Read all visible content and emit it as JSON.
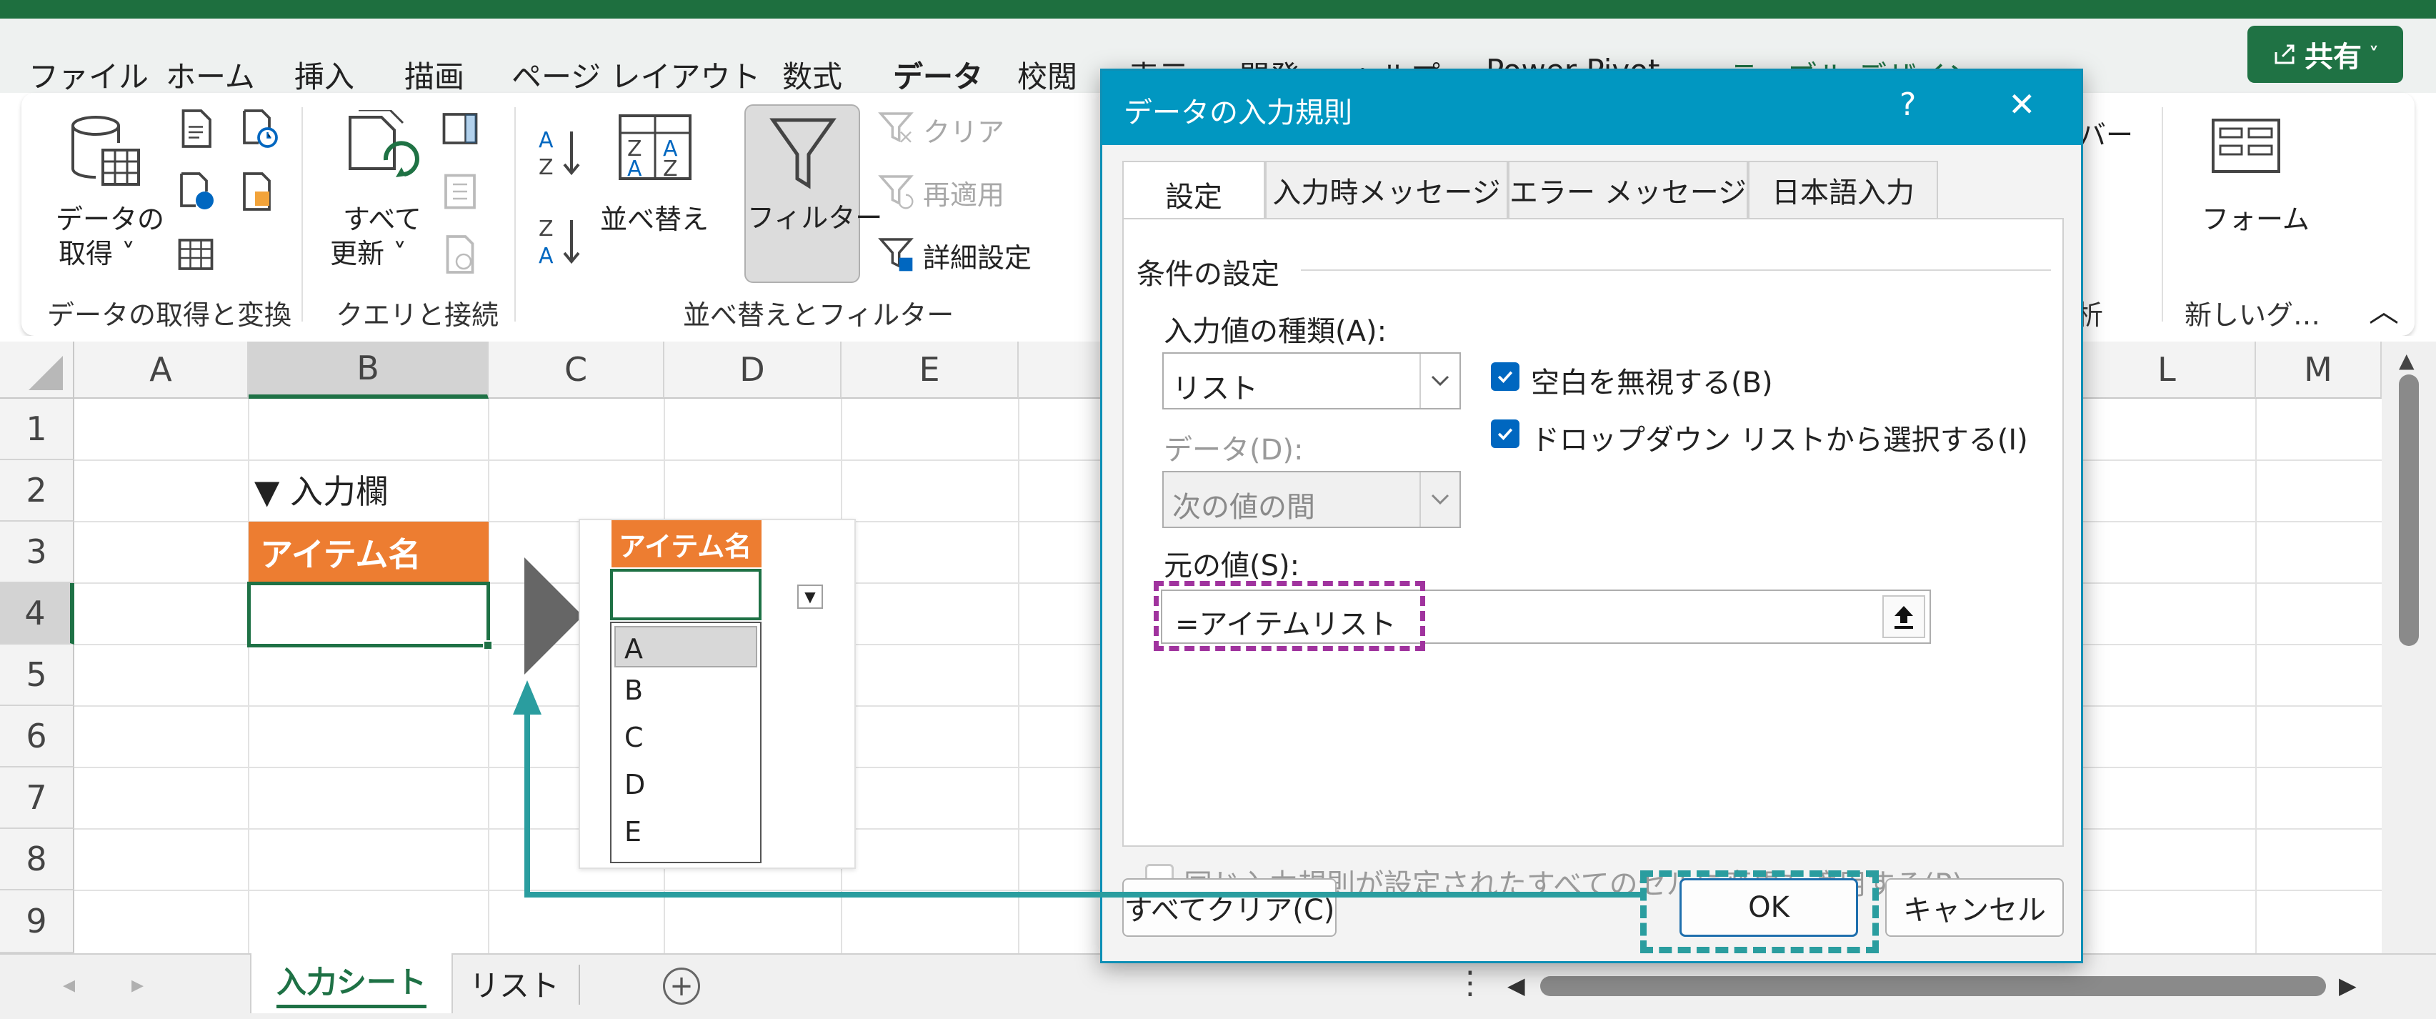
{
  "menu": {
    "tabs": [
      "ファイル",
      "ホーム",
      "挿入",
      "描画",
      "ページ レイアウト",
      "数式",
      "データ",
      "校閲",
      "表示",
      "開発",
      "ヘルプ",
      "Power Pivot",
      "テーブル デザイン"
    ],
    "active": "データ",
    "share_label": "共有"
  },
  "ribbon": {
    "get_data_label_1": "データの",
    "get_data_label_2": "取得 ˅",
    "refresh_label_1": "すべて",
    "refresh_label_2": "更新 ˅",
    "sort_label": "並べ替え",
    "filter_label": "フィルター",
    "clear_label": "クリア",
    "reapply_label": "再適用",
    "advanced_label": "詳細設定",
    "bar_label": "バー",
    "form_label": "フォーム",
    "groups": {
      "get_transform": "データの取得と変換",
      "queries": "クエリと接続",
      "sort_filter": "並べ替えとフィルター",
      "new_group": "新しいグ…",
      "partial": "析"
    },
    "collapse_glyph": "︿"
  },
  "sheet": {
    "columns": [
      "A",
      "B",
      "C",
      "D",
      "E",
      "L",
      "M"
    ],
    "rows": [
      "1",
      "2",
      "3",
      "4",
      "5",
      "6",
      "7",
      "8",
      "9"
    ],
    "input_heading": "▼ 入力欄",
    "item_header": "アイテム名"
  },
  "illustration": {
    "header": "アイテム名",
    "options": [
      "A",
      "B",
      "C",
      "D",
      "E"
    ]
  },
  "dialog": {
    "title": "データの入力規則",
    "help": "?",
    "close": "✕",
    "tabs": [
      "設定",
      "入力時メッセージ",
      "エラー メッセージ",
      "日本語入力"
    ],
    "section": "条件の設定",
    "allow_label": "入力値の種類(A):",
    "allow_value": "リスト",
    "ignore_blank": "空白を無視する(B)",
    "dropdown": "ドロップダウン リストから選択する(I)",
    "data_label": "データ(D):",
    "data_value": "次の値の間",
    "source_label": "元の値(S):",
    "source_value": "=アイテムリスト",
    "apply_all": "同じ入力規則が設定されたすべてのセルに変更を適用する(P)",
    "clear_all": "すべてクリア(C)",
    "ok": "OK",
    "cancel": "キャンセル"
  },
  "sheet_tabs": {
    "tabs": [
      "入力シート",
      "リスト"
    ],
    "active": "入力シート",
    "add": "+"
  },
  "colors": {
    "excel_green": "#1f7244",
    "orange": "#ed7d31",
    "dialog_blue": "#0197c1",
    "teal_highlight": "#2a9d9f",
    "purple_highlight": "#a0339e"
  }
}
